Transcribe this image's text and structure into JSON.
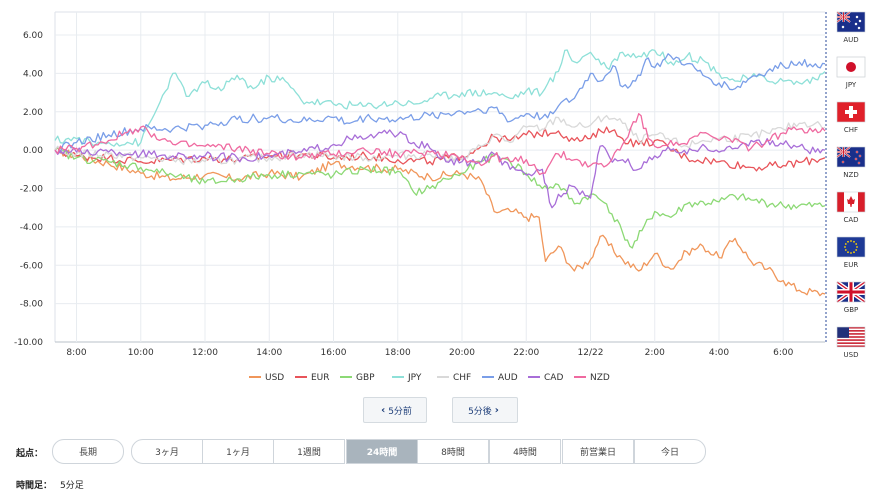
{
  "chart_data": {
    "type": "line",
    "ylim": [
      -10,
      7.2
    ],
    "yticks": [
      6,
      4,
      2,
      0,
      -2,
      -4,
      -6,
      -8,
      -10
    ],
    "ytick_labels": [
      "6.00",
      "4.00",
      "2.00",
      "0.00",
      "-2.00",
      "-4.00",
      "-6.00",
      "-8.00",
      "-10.00"
    ],
    "x_range": [
      7.33,
      31.3
    ],
    "xticks": [
      8,
      10,
      12,
      14,
      16,
      18,
      20,
      22,
      24,
      26,
      28,
      30
    ],
    "xtick_labels": [
      "8:00",
      "10:00",
      "12:00",
      "14:00",
      "16:00",
      "18:00",
      "20:00",
      "22:00",
      "12/22",
      "2:00",
      "4:00",
      "6:00"
    ],
    "grid": true,
    "series": [
      {
        "name": "USD",
        "color": "#f0965a",
        "values": [
          [
            7.33,
            0
          ],
          [
            8,
            -0.3
          ],
          [
            9,
            -0.7
          ],
          [
            10,
            -1.2
          ],
          [
            11,
            -1.5
          ],
          [
            12,
            -1.3
          ],
          [
            13,
            -1.5
          ],
          [
            14,
            -1.2
          ],
          [
            15,
            -1.4
          ],
          [
            16,
            -0.7
          ],
          [
            17,
            -0.9
          ],
          [
            18,
            -1.0
          ],
          [
            19,
            -1.4
          ],
          [
            20,
            -1.2
          ],
          [
            20.6,
            -1.6
          ],
          [
            21,
            -3.2
          ],
          [
            21.6,
            -3.2
          ],
          [
            22,
            -3.5
          ],
          [
            22.4,
            -3.5
          ],
          [
            22.6,
            -5.8
          ],
          [
            23,
            -5.0
          ],
          [
            23.5,
            -6.3
          ],
          [
            24,
            -5.7
          ],
          [
            24.3,
            -4.5
          ],
          [
            25,
            -5.7
          ],
          [
            25.5,
            -6.3
          ],
          [
            26,
            -5.4
          ],
          [
            26.5,
            -6.2
          ],
          [
            27,
            -5.3
          ],
          [
            27.5,
            -5.0
          ],
          [
            28,
            -5.6
          ],
          [
            28.5,
            -4.6
          ],
          [
            29,
            -5.8
          ],
          [
            29.5,
            -6.2
          ],
          [
            30,
            -6.8
          ],
          [
            30.5,
            -7.3
          ],
          [
            31.3,
            -7.5
          ]
        ]
      },
      {
        "name": "EUR",
        "color": "#e8545a",
        "values": [
          [
            7.33,
            0
          ],
          [
            8,
            -0.3
          ],
          [
            9,
            -0.4
          ],
          [
            10,
            -0.6
          ],
          [
            11,
            -0.5
          ],
          [
            12,
            -0.4
          ],
          [
            13,
            -0.5
          ],
          [
            14,
            -0.3
          ],
          [
            15,
            -0.2
          ],
          [
            16,
            -0.4
          ],
          [
            17,
            -0.3
          ],
          [
            18,
            -0.5
          ],
          [
            19,
            -0.6
          ],
          [
            20,
            -0.3
          ],
          [
            20.6,
            0.2
          ],
          [
            21,
            0.7
          ],
          [
            21.5,
            0.5
          ],
          [
            22,
            0.8
          ],
          [
            23,
            1.0
          ],
          [
            23.5,
            0.5
          ],
          [
            24,
            0.6
          ],
          [
            24.5,
            1.2
          ],
          [
            25,
            0.6
          ],
          [
            25.5,
            0.3
          ],
          [
            26,
            0.5
          ],
          [
            27,
            -0.4
          ],
          [
            28,
            -0.6
          ],
          [
            29,
            -0.9
          ],
          [
            30,
            -0.8
          ],
          [
            31.3,
            -0.4
          ]
        ]
      },
      {
        "name": "GBP",
        "color": "#8cd975",
        "values": [
          [
            7.33,
            0
          ],
          [
            8,
            -0.4
          ],
          [
            9,
            -0.6
          ],
          [
            10,
            -0.9
          ],
          [
            11,
            -1.3
          ],
          [
            12,
            -1.7
          ],
          [
            13,
            -1.5
          ],
          [
            14,
            -1.3
          ],
          [
            15,
            -1.2
          ],
          [
            16,
            -1.3
          ],
          [
            17,
            -1.0
          ],
          [
            18,
            -1.1
          ],
          [
            18.5,
            -2.2
          ],
          [
            19,
            -2.0
          ],
          [
            19.5,
            -1.5
          ],
          [
            20,
            -1.2
          ],
          [
            20.6,
            -0.6
          ],
          [
            21,
            -0.3
          ],
          [
            21.5,
            -0.6
          ],
          [
            22,
            -1.2
          ],
          [
            22.5,
            -2.0
          ],
          [
            23,
            -1.8
          ],
          [
            23.5,
            -2.8
          ],
          [
            24,
            -2.3
          ],
          [
            24.5,
            -2.8
          ],
          [
            25,
            -4.3
          ],
          [
            25.3,
            -5.1
          ],
          [
            25.6,
            -4.2
          ],
          [
            26,
            -3.2
          ],
          [
            26.5,
            -3.5
          ],
          [
            27,
            -2.8
          ],
          [
            28,
            -2.7
          ],
          [
            28.5,
            -2.4
          ],
          [
            29,
            -2.6
          ],
          [
            30,
            -2.9
          ],
          [
            31.3,
            -2.9
          ]
        ]
      },
      {
        "name": "JPY",
        "color": "#8ee0d8",
        "values": [
          [
            7.33,
            0.5
          ],
          [
            8,
            0.6
          ],
          [
            8.6,
            0.3
          ],
          [
            9,
            0.4
          ],
          [
            10,
            0.4
          ],
          [
            10.6,
            2.5
          ],
          [
            11,
            4.0
          ],
          [
            11.5,
            2.8
          ],
          [
            12,
            3.5
          ],
          [
            12.5,
            3.1
          ],
          [
            13,
            3.9
          ],
          [
            13.5,
            3.2
          ],
          [
            14,
            3.8
          ],
          [
            14.5,
            3.6
          ],
          [
            15,
            2.6
          ],
          [
            16,
            2.4
          ],
          [
            17,
            2.3
          ],
          [
            18,
            2.5
          ],
          [
            18.5,
            2.4
          ],
          [
            19,
            2.7
          ],
          [
            20,
            3.0
          ],
          [
            21,
            3.0
          ],
          [
            21.5,
            2.7
          ],
          [
            22,
            3.1
          ],
          [
            22.5,
            3.0
          ],
          [
            23,
            4.1
          ],
          [
            23.2,
            5.2
          ],
          [
            23.5,
            4.6
          ],
          [
            24,
            5.1
          ],
          [
            24.5,
            4.3
          ],
          [
            25,
            5.1
          ],
          [
            25.5,
            4.9
          ],
          [
            26,
            5.2
          ],
          [
            26.5,
            4.6
          ],
          [
            27,
            4.9
          ],
          [
            27.5,
            4.7
          ],
          [
            28,
            4.0
          ],
          [
            28.5,
            3.6
          ],
          [
            29,
            3.8
          ],
          [
            30,
            3.6
          ],
          [
            30.5,
            3.5
          ],
          [
            31,
            3.7
          ],
          [
            31.3,
            4.1
          ]
        ]
      },
      {
        "name": "CHF",
        "color": "#d9d9d9",
        "values": [
          [
            7.33,
            0
          ],
          [
            8,
            -0.2
          ],
          [
            9,
            -0.2
          ],
          [
            10,
            -0.4
          ],
          [
            11,
            -0.5
          ],
          [
            12,
            -0.6
          ],
          [
            13,
            -0.5
          ],
          [
            14,
            -0.4
          ],
          [
            15,
            -0.2
          ],
          [
            16,
            -0.3
          ],
          [
            17,
            -0.4
          ],
          [
            18,
            -0.3
          ],
          [
            19,
            -0.2
          ],
          [
            20,
            -0.5
          ],
          [
            20.6,
            0.2
          ],
          [
            21,
            0.8
          ],
          [
            21.5,
            0.4
          ],
          [
            22,
            1.2
          ],
          [
            22.5,
            1.1
          ],
          [
            23,
            1.7
          ],
          [
            23.5,
            1.2
          ],
          [
            24,
            1.3
          ],
          [
            24.5,
            1.8
          ],
          [
            25,
            1.4
          ],
          [
            25.5,
            0.5
          ],
          [
            26,
            0.8
          ],
          [
            27,
            0.2
          ],
          [
            27.5,
            0.5
          ],
          [
            28,
            0.6
          ],
          [
            29,
            0.7
          ],
          [
            29.5,
            0.9
          ],
          [
            30,
            1.1
          ],
          [
            30.5,
            1.4
          ],
          [
            31,
            1.4
          ],
          [
            31.3,
            1.2
          ]
        ]
      },
      {
        "name": "AUD",
        "color": "#7a9ee8",
        "values": [
          [
            7.33,
            0
          ],
          [
            8,
            0.4
          ],
          [
            9,
            0.8
          ],
          [
            10,
            1.1
          ],
          [
            11,
            1.1
          ],
          [
            12,
            1.3
          ],
          [
            13,
            1.6
          ],
          [
            14,
            1.7
          ],
          [
            15,
            1.5
          ],
          [
            16,
            1.7
          ],
          [
            16.5,
            1.4
          ],
          [
            17,
            1.7
          ],
          [
            18,
            1.6
          ],
          [
            19,
            1.8
          ],
          [
            20,
            2.0
          ],
          [
            21,
            2.2
          ],
          [
            21.5,
            1.5
          ],
          [
            22,
            1.9
          ],
          [
            22.5,
            1.7
          ],
          [
            23,
            2.3
          ],
          [
            23.5,
            2.7
          ],
          [
            24,
            4.0
          ],
          [
            24.3,
            3.6
          ],
          [
            24.7,
            4.4
          ],
          [
            25,
            3.3
          ],
          [
            25.4,
            3.6
          ],
          [
            25.8,
            4.8
          ],
          [
            26,
            4.3
          ],
          [
            26.5,
            4.9
          ],
          [
            27,
            4.5
          ],
          [
            27.5,
            3.9
          ],
          [
            28,
            3.5
          ],
          [
            28.5,
            3.2
          ],
          [
            29,
            3.8
          ],
          [
            29.5,
            4.1
          ],
          [
            30,
            4.4
          ],
          [
            30.5,
            4.6
          ],
          [
            31,
            4.5
          ],
          [
            31.3,
            4.5
          ]
        ]
      },
      {
        "name": "CAD",
        "color": "#a86ed8",
        "values": [
          [
            7.33,
            0
          ],
          [
            8,
            -0.1
          ],
          [
            9,
            -0.1
          ],
          [
            10,
            -0.2
          ],
          [
            11,
            -0.3
          ],
          [
            12,
            -0.3
          ],
          [
            13,
            -0.4
          ],
          [
            14,
            -0.3
          ],
          [
            15,
            -0.1
          ],
          [
            16,
            0.3
          ],
          [
            16.5,
            0.6
          ],
          [
            17,
            0.6
          ],
          [
            17.5,
            0.9
          ],
          [
            18,
            0.8
          ],
          [
            18.5,
            0.4
          ],
          [
            19,
            0.1
          ],
          [
            19.5,
            -0.6
          ],
          [
            20,
            -0.6
          ],
          [
            20.6,
            -0.6
          ],
          [
            21,
            -0.2
          ],
          [
            21.5,
            -1.0
          ],
          [
            22,
            -1.3
          ],
          [
            22.5,
            -1.0
          ],
          [
            22.8,
            -3.0
          ],
          [
            23,
            -2.3
          ],
          [
            23.5,
            -1.9
          ],
          [
            24,
            -2.5
          ],
          [
            24.3,
            0.2
          ],
          [
            24.6,
            -0.4
          ],
          [
            25,
            -0.5
          ],
          [
            25.5,
            -1.0
          ],
          [
            26,
            -0.3
          ],
          [
            26.5,
            0.0
          ],
          [
            27,
            -0.2
          ],
          [
            27.5,
            0.3
          ],
          [
            28,
            -0.1
          ],
          [
            28.5,
            0.1
          ],
          [
            29,
            0.5
          ],
          [
            30,
            0.3
          ],
          [
            30.5,
            0.2
          ],
          [
            31,
            -0.1
          ],
          [
            31.3,
            0.0
          ]
        ]
      },
      {
        "name": "NZD",
        "color": "#ef6aa0",
        "values": [
          [
            7.33,
            0
          ],
          [
            8,
            0.1
          ],
          [
            9,
            0.5
          ],
          [
            9.5,
            0.9
          ],
          [
            10,
            1.2
          ],
          [
            11,
            0.3
          ],
          [
            12,
            0.2
          ],
          [
            13,
            0.1
          ],
          [
            14,
            -0.2
          ],
          [
            15,
            -0.4
          ],
          [
            16,
            -0.2
          ],
          [
            17,
            0.0
          ],
          [
            18,
            -0.2
          ],
          [
            19,
            -0.1
          ],
          [
            20,
            -0.3
          ],
          [
            20.6,
            -0.8
          ],
          [
            21,
            -0.3
          ],
          [
            21.5,
            -0.6
          ],
          [
            22,
            -0.5
          ],
          [
            22.5,
            -1.2
          ],
          [
            23,
            -0.2
          ],
          [
            23.5,
            -0.5
          ],
          [
            24,
            -0.8
          ],
          [
            24.5,
            -0.8
          ],
          [
            25,
            0.3
          ],
          [
            25.5,
            1.9
          ],
          [
            25.8,
            0.6
          ],
          [
            26,
            0.2
          ],
          [
            26.5,
            0.5
          ],
          [
            27,
            0.3
          ],
          [
            27.5,
            0.9
          ],
          [
            28,
            0.5
          ],
          [
            28.5,
            0.6
          ],
          [
            29,
            0.1
          ],
          [
            29.5,
            0.5
          ],
          [
            30,
            0.9
          ],
          [
            30.5,
            1.1
          ],
          [
            31,
            1.1
          ],
          [
            31.3,
            1.0
          ]
        ]
      }
    ]
  },
  "flags": [
    {
      "code": "AUD",
      "icon": "australia-flag"
    },
    {
      "code": "JPY",
      "icon": "japan-flag"
    },
    {
      "code": "CHF",
      "icon": "switzerland-flag"
    },
    {
      "code": "NZD",
      "icon": "new-zealand-flag"
    },
    {
      "code": "CAD",
      "icon": "canada-flag"
    },
    {
      "code": "EUR",
      "icon": "eu-flag"
    },
    {
      "code": "GBP",
      "icon": "uk-flag"
    },
    {
      "code": "USD",
      "icon": "us-flag"
    }
  ],
  "navigation": {
    "prev_label": "5分前",
    "next_label": "5分後"
  },
  "period": {
    "label": "起点：",
    "options": [
      "長期",
      "3ヶ月",
      "1ヶ月",
      "1週間",
      "24時間",
      "8時間",
      "4時間",
      "前営業日",
      "今日"
    ],
    "selected": "24時間"
  },
  "timeframe": {
    "label": "時間足：",
    "value": "5分足"
  }
}
